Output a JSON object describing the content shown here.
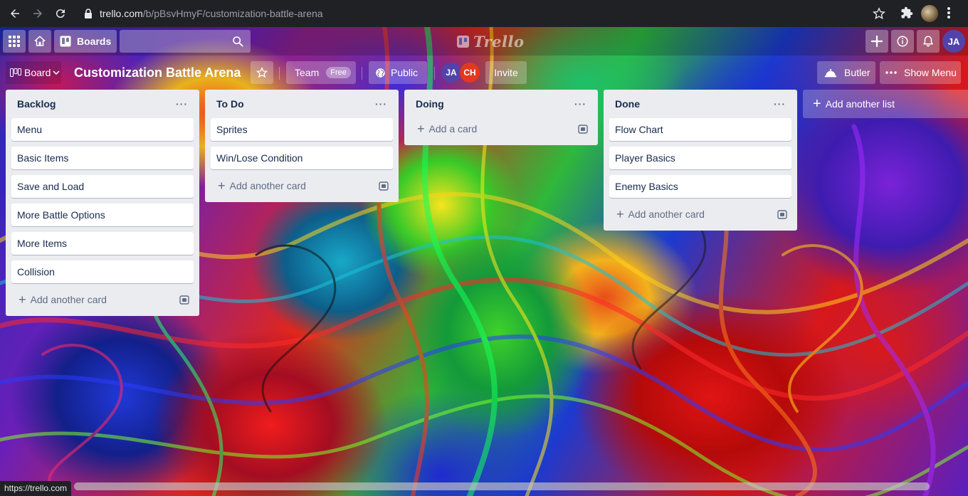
{
  "browser": {
    "url_host": "trello.com",
    "url_path": "/b/pBsvHmyF/customization-battle-arena",
    "status_url": "https://trello.com"
  },
  "header": {
    "boards_label": "Boards",
    "logo_text": "Trello",
    "user_initials": "JA"
  },
  "board": {
    "switcher_label": "Board",
    "title": "Customization Battle Arena",
    "team_label": "Team",
    "team_badge": "Free",
    "visibility_label": "Public",
    "members": [
      {
        "initials": "JA",
        "color": "#5243aa"
      },
      {
        "initials": "CH",
        "color": "#e0391f"
      }
    ],
    "invite_label": "Invite",
    "butler_label": "Butler",
    "menu_label": "Show Menu"
  },
  "lists": [
    {
      "title": "Backlog",
      "cards": [
        "Menu",
        "Basic Items",
        "Save and Load",
        "More Battle Options",
        "More Items",
        "Collision"
      ],
      "add_label": "Add another card"
    },
    {
      "title": "To Do",
      "cards": [
        "Sprites",
        "Win/Lose Condition"
      ],
      "add_label": "Add another card"
    },
    {
      "title": "Doing",
      "cards": [],
      "add_label": "Add a card"
    },
    {
      "title": "Done",
      "cards": [
        "Flow Chart",
        "Player Basics",
        "Enemy Basics"
      ],
      "add_label": "Add another card"
    }
  ],
  "add_list_label": "Add another list"
}
